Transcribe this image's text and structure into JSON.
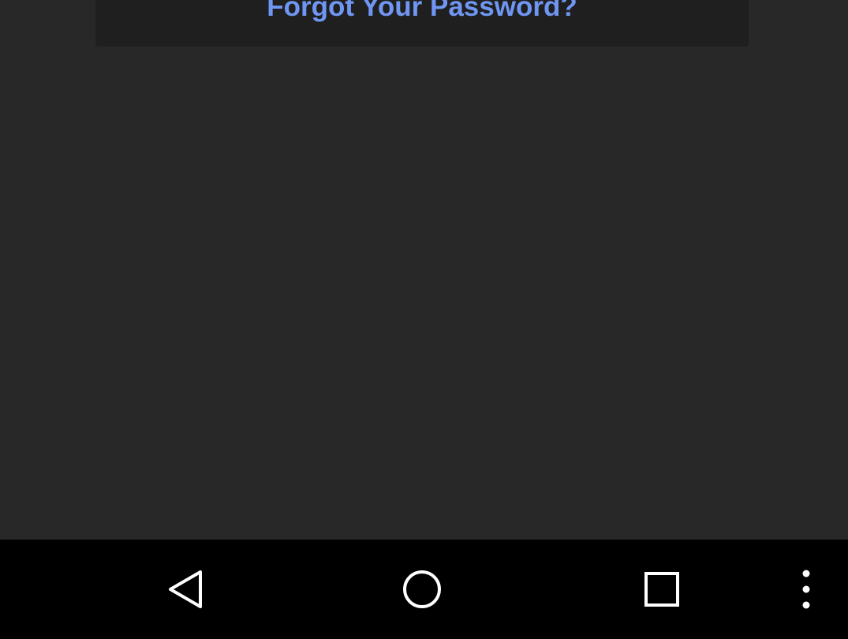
{
  "login": {
    "forgot_password_label": "Forgot Your Password?"
  },
  "colors": {
    "background": "#282828",
    "card": "#1f1f1f",
    "link": "#6f96f2",
    "nav_bar": "#000000",
    "nav_icon": "#ffffff"
  },
  "navigation_bar": {
    "buttons": [
      {
        "icon": "back-triangle-icon"
      },
      {
        "icon": "home-circle-icon"
      },
      {
        "icon": "recents-square-icon"
      },
      {
        "icon": "overflow-menu-icon"
      }
    ]
  }
}
